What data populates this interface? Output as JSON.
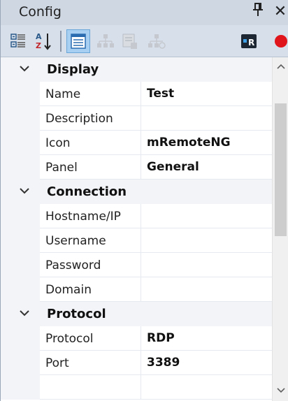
{
  "window": {
    "title": "Config",
    "pin_glyph": "p",
    "close_glyph": "✕"
  },
  "toolbar": {
    "buttons": [
      {
        "name": "categorized-view-icon",
        "active": false
      },
      {
        "name": "alphabetical-sort-icon",
        "active": false
      },
      {
        "name": "property-pages-icon",
        "active": true
      },
      {
        "name": "inheritance-icon",
        "active": false
      },
      {
        "name": "default-properties-icon",
        "active": false
      },
      {
        "name": "default-inheritance-icon",
        "active": false
      },
      {
        "name": "rdp-icon",
        "active": false
      },
      {
        "name": "record-icon",
        "active": false
      }
    ]
  },
  "grid": {
    "categories": [
      {
        "label": "Display",
        "properties": [
          {
            "name": "Name",
            "value": "Test"
          },
          {
            "name": "Description",
            "value": ""
          },
          {
            "name": "Icon",
            "value": "mRemoteNG"
          },
          {
            "name": "Panel",
            "value": "General"
          }
        ]
      },
      {
        "label": "Connection",
        "properties": [
          {
            "name": "Hostname/IP",
            "value": ""
          },
          {
            "name": "Username",
            "value": ""
          },
          {
            "name": "Password",
            "value": ""
          },
          {
            "name": "Domain",
            "value": ""
          }
        ]
      },
      {
        "label": "Protocol",
        "properties": [
          {
            "name": "Protocol",
            "value": "RDP"
          },
          {
            "name": "Port",
            "value": "3389"
          }
        ]
      }
    ]
  },
  "colors": {
    "title_bg": "#cfd7e3",
    "toolbar_bg": "#d7dfea",
    "active_button": "#a6cff2",
    "record_red": "#e0151c"
  }
}
